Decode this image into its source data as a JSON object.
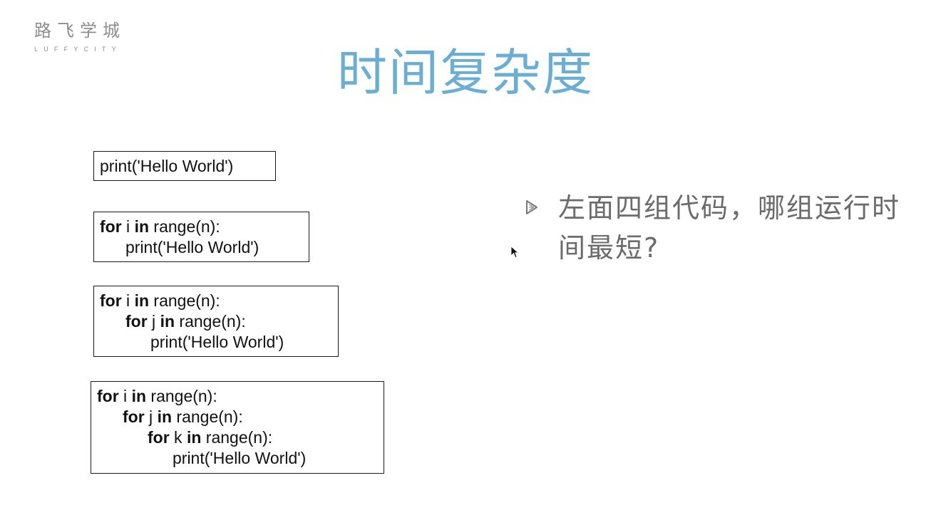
{
  "logo": {
    "chinese": "路飞学城",
    "english": "LUFFYCITY"
  },
  "slide": {
    "title": "时间复杂度",
    "code_blocks": [
      {
        "lines": [
          {
            "keyword1": "",
            "mid1": "print('Hello World')",
            "keyword2": "",
            "rest": ""
          }
        ]
      },
      {
        "lines": [
          {
            "keyword1": "for",
            "mid1": " i ",
            "keyword2": "in",
            "rest": " range(n):"
          },
          {
            "keyword1": "",
            "mid1": "print('Hello World')",
            "keyword2": "",
            "rest": ""
          }
        ]
      },
      {
        "lines": [
          {
            "keyword1": "for",
            "mid1": " i ",
            "keyword2": "in",
            "rest": " range(n):"
          },
          {
            "keyword1": "for",
            "mid1": " j ",
            "keyword2": "in",
            "rest": " range(n):"
          },
          {
            "keyword1": "",
            "mid1": "print('Hello World')",
            "keyword2": "",
            "rest": ""
          }
        ]
      },
      {
        "lines": [
          {
            "keyword1": "for",
            "mid1": " i ",
            "keyword2": "in",
            "rest": " range(n):"
          },
          {
            "keyword1": "for",
            "mid1": " j ",
            "keyword2": "in",
            "rest": " range(n):"
          },
          {
            "keyword1": "for",
            "mid1": " k ",
            "keyword2": "in",
            "rest": " range(n):"
          },
          {
            "keyword1": "",
            "mid1": "print('Hello World')",
            "keyword2": "",
            "rest": ""
          }
        ]
      }
    ],
    "question": "左面四组代码，哪组运行时间最短?"
  },
  "colors": {
    "title": "#6aaed6",
    "logo": "#8c8c8c",
    "question": "#6b6b6b",
    "code_border": "#1a1a1a"
  },
  "icons": {
    "bullet": "triangle-bullet-icon",
    "cursor": "mouse-pointer-icon"
  }
}
